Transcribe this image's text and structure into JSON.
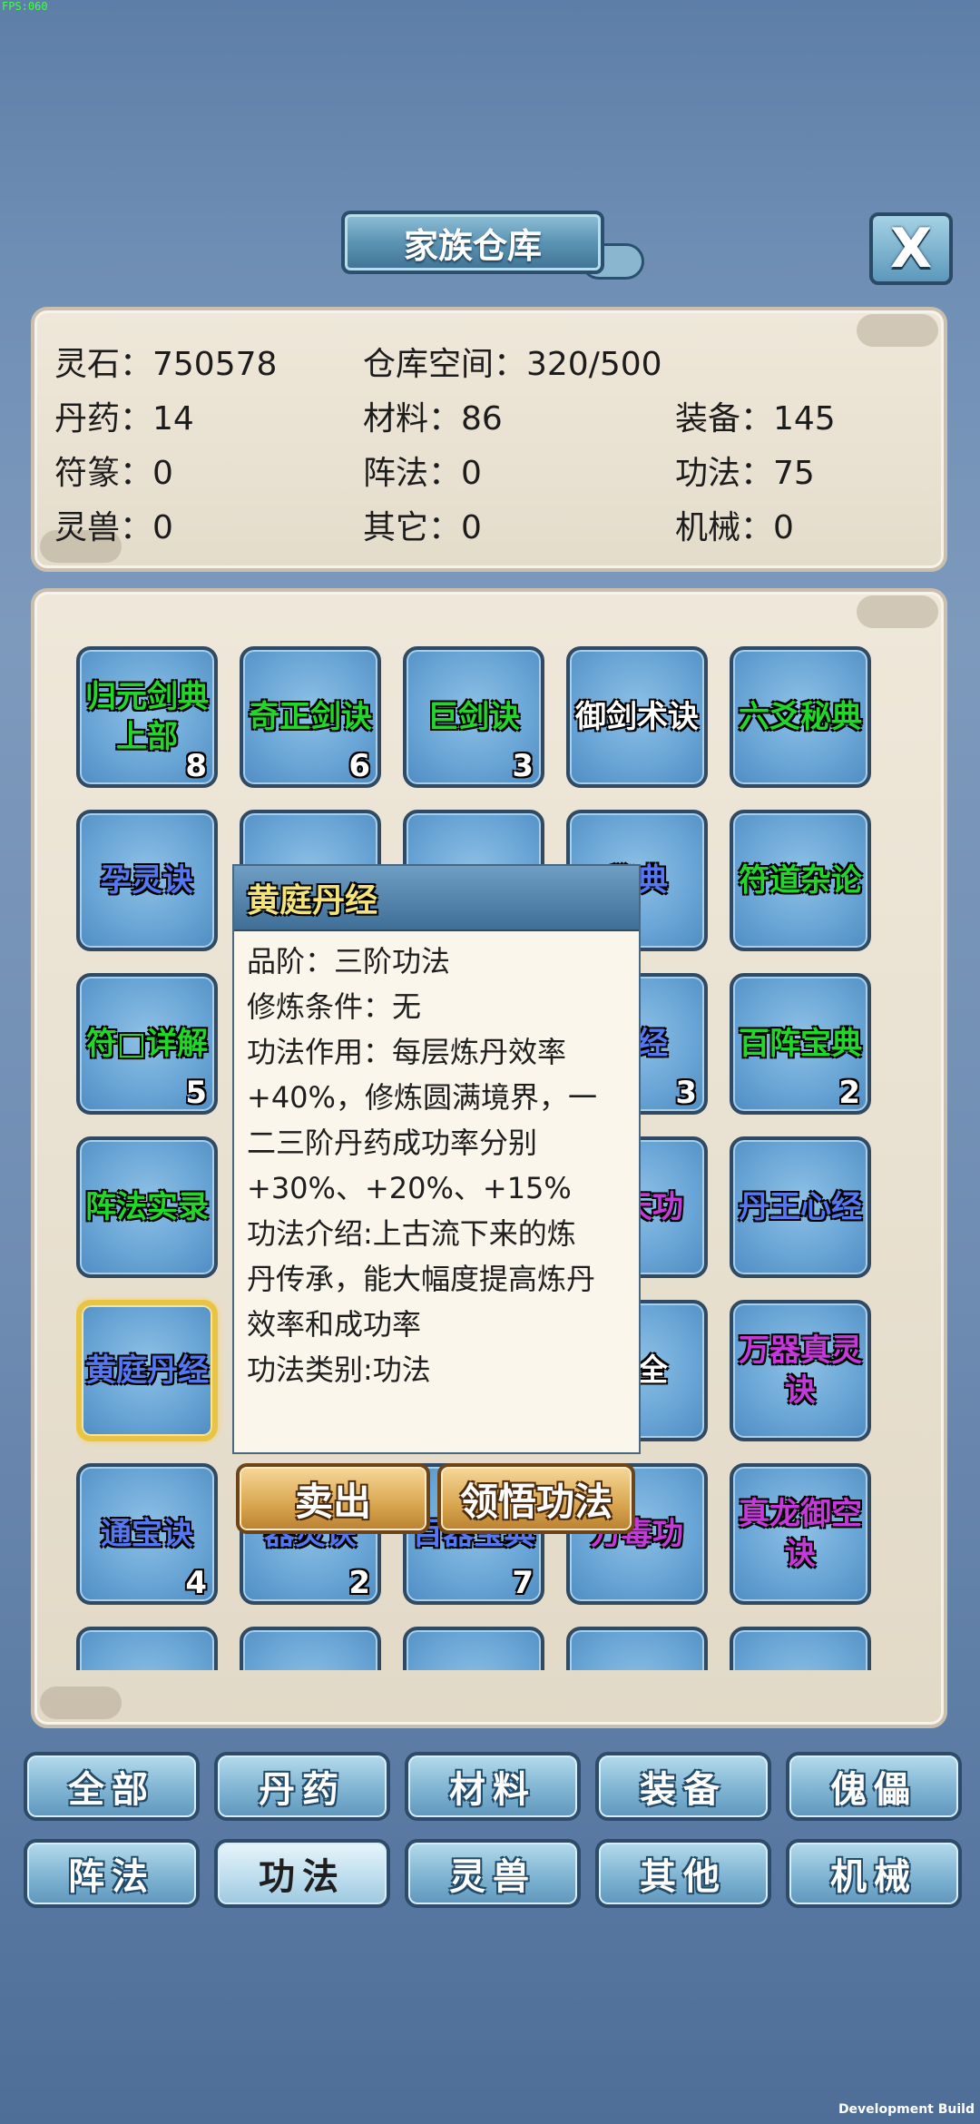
{
  "debug": {
    "fps": "FPS:060",
    "build": "Development Build"
  },
  "title": "家族仓库",
  "close_label": "X",
  "info": {
    "spirit_stone": "灵石：750578",
    "storage": "仓库空间：320/500",
    "pills": "丹药：14",
    "materials": "材料：86",
    "equipment": "装备：145",
    "talismans": "符篆：0",
    "formations": "阵法：0",
    "techniques": "功法：75",
    "beasts": "灵兽：0",
    "others": "其它：0",
    "machines": "机械：0"
  },
  "grid_items": [
    {
      "name": "归元剑典上部",
      "count": "8",
      "color": "green"
    },
    {
      "name": "奇正剑诀",
      "count": "6",
      "color": "green"
    },
    {
      "name": "巨剑诀",
      "count": "3",
      "color": "green"
    },
    {
      "name": "御剑术诀",
      "count": "",
      "color": "white"
    },
    {
      "name": "六爻秘典",
      "count": "",
      "color": "green"
    },
    {
      "name": "孕灵诀",
      "count": "",
      "color": "blue"
    },
    {
      "name": "",
      "count": "",
      "color": "white"
    },
    {
      "name": "",
      "count": "",
      "color": "white"
    },
    {
      "name": "秘典",
      "count": "",
      "color": "blue"
    },
    {
      "name": "符道杂论",
      "count": "",
      "color": "green"
    },
    {
      "name": "符□详解",
      "count": "5",
      "color": "green"
    },
    {
      "name": "",
      "count": "",
      "color": "white"
    },
    {
      "name": "",
      "count": "",
      "color": "white"
    },
    {
      "name": "真经",
      "count": "3",
      "color": "blue"
    },
    {
      "name": "百阵宝典",
      "count": "2",
      "color": "green"
    },
    {
      "name": "阵法实录",
      "count": "",
      "color": "green"
    },
    {
      "name": "",
      "count": "",
      "color": "white"
    },
    {
      "name": "",
      "count": "",
      "color": "white"
    },
    {
      "name": "通天功",
      "count": "",
      "color": "purple"
    },
    {
      "name": "丹王心经",
      "count": "",
      "color": "blue"
    },
    {
      "name": "黄庭丹经",
      "count": "",
      "color": "blue"
    },
    {
      "name": "",
      "count": "",
      "color": "white"
    },
    {
      "name": "",
      "count": "",
      "color": "white"
    },
    {
      "name": "大全",
      "count": "",
      "color": "white"
    },
    {
      "name": "万器真灵诀",
      "count": "",
      "color": "purple"
    },
    {
      "name": "通宝诀",
      "count": "4",
      "color": "blue"
    },
    {
      "name": "器灵诀",
      "count": "2",
      "color": "blue"
    },
    {
      "name": "百器宝典",
      "count": "7",
      "color": "blue"
    },
    {
      "name": "万毒功",
      "count": "",
      "color": "purple"
    },
    {
      "name": "真龙御空诀",
      "count": "",
      "color": "purple"
    },
    {
      "name": "",
      "count": "",
      "color": "white"
    },
    {
      "name": "",
      "count": "",
      "color": "white"
    },
    {
      "name": "",
      "count": "",
      "color": "white"
    },
    {
      "name": "",
      "count": "",
      "color": "purple"
    },
    {
      "name": "",
      "count": "",
      "color": "purple"
    }
  ],
  "tooltip": {
    "name": "黄庭丹经",
    "lines": [
      "品阶：三阶功法",
      "修炼条件：无",
      "功法作用：每层炼丹效率",
      "+40%，修炼圆满境界，一",
      "二三阶丹药成功率分别",
      "+30%、+20%、+15%",
      "功法介绍:上古流下来的炼",
      "丹传承，能大幅度提高炼丹",
      "效率和成功率",
      "功法类别:功法"
    ]
  },
  "actions": {
    "sell": "卖出",
    "comprehend": "领悟功法"
  },
  "tabs": [
    "全部",
    "丹药",
    "材料",
    "装备",
    "傀儡",
    "阵法",
    "功法",
    "灵兽",
    "其他",
    "机械"
  ],
  "active_tab": "功法"
}
